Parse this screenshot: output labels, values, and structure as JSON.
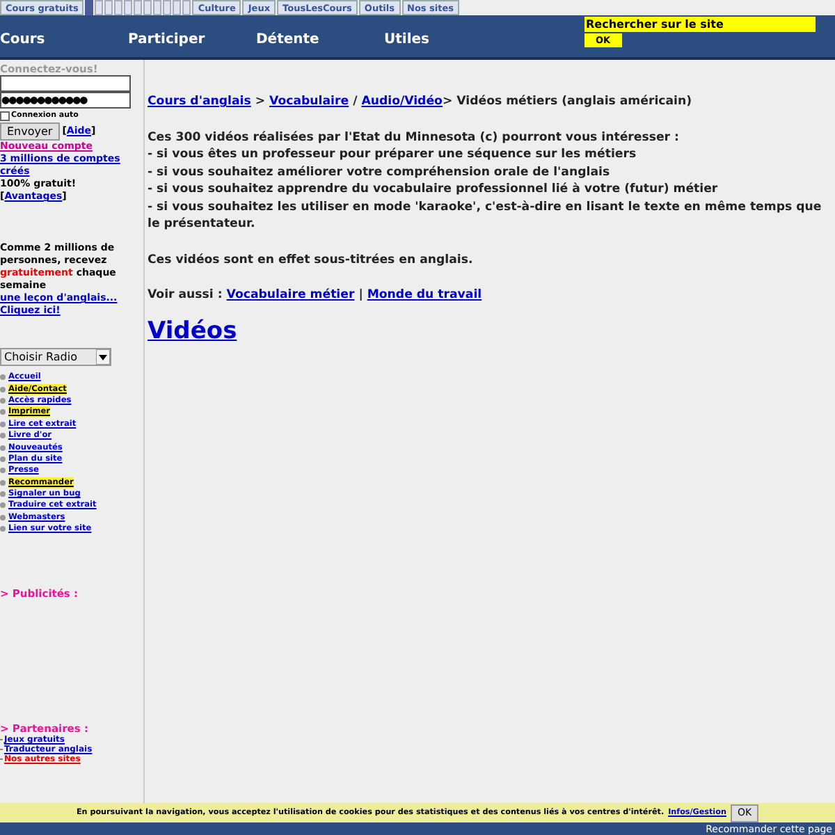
{
  "top_tabs": [
    {
      "label": "Cours gratuits",
      "kind": "text"
    },
    {
      "kind": "active"
    },
    {
      "kind": "blank"
    },
    {
      "kind": "blank"
    },
    {
      "kind": "blank"
    },
    {
      "kind": "blank"
    },
    {
      "kind": "blank"
    },
    {
      "kind": "blank"
    },
    {
      "kind": "blank"
    },
    {
      "kind": "blank"
    },
    {
      "kind": "blank"
    },
    {
      "kind": "blank"
    },
    {
      "label": "Culture",
      "kind": "text"
    },
    {
      "label": "Jeux",
      "kind": "text"
    },
    {
      "label": "TousLesCours",
      "kind": "text"
    },
    {
      "label": "Outils",
      "kind": "text"
    },
    {
      "label": "Nos sites",
      "kind": "text"
    }
  ],
  "nav": [
    "Cours",
    "Participer",
    "Détente",
    "Utiles"
  ],
  "search": {
    "label": "Rechercher sur le site",
    "button": "OK"
  },
  "login": {
    "title": "Connectez-vous!",
    "password": "●●●●●●●●●●●●",
    "auto_label": "Connexion auto",
    "auto_checked": false,
    "submit": "Envoyer",
    "help_open": "[",
    "help": "Aide",
    "help_close": "]",
    "new_account": "Nouveau compte",
    "accounts": "3 millions de comptes créés",
    "free": "100% gratuit!",
    "adv_open": "[",
    "advantages": "Avantages",
    "adv_close": "]"
  },
  "promo": {
    "text_1": "Comme 2 millions de personnes, recevez",
    "highlight": "gratuitement",
    "text_2": "chaque semaine",
    "link": "une leçon d'anglais...",
    "cta": "Cliquez ici!"
  },
  "radio": {
    "label": "Choisir Radio"
  },
  "menu": [
    {
      "label": "Accueil",
      "highlighted": false
    },
    {
      "label": "Aide/Contact",
      "highlighted": true
    },
    {
      "label": "Accès rapides",
      "highlighted": false
    },
    {
      "label": "Imprimer",
      "highlighted": true
    },
    {
      "label": "Lire cet extrait",
      "highlighted": false
    },
    {
      "label": "Livre d'or",
      "highlighted": false
    },
    {
      "label": "Nouveautés",
      "highlighted": false
    },
    {
      "label": "Plan du site",
      "highlighted": false
    },
    {
      "label": "Presse",
      "highlighted": false
    },
    {
      "label": "Recommander",
      "highlighted": true
    },
    {
      "label": "Signaler un bug",
      "highlighted": false
    },
    {
      "label": "Traduire cet extrait",
      "highlighted": false
    },
    {
      "label": "Webmasters",
      "highlighted": false
    },
    {
      "label": "Lien sur votre site",
      "highlighted": false
    }
  ],
  "ads_heading": "> Publicités :",
  "partners": {
    "heading": "> Partenaires :",
    "links": [
      {
        "label": "Jeux gratuits",
        "color": "#0000cc"
      },
      {
        "label": "Traducteur anglais",
        "color": "#0000cc"
      },
      {
        "label": "Nos autres sites",
        "color": "#ee0000"
      }
    ]
  },
  "breadcrumb": {
    "links": [
      "Cours d'anglais",
      "Vocabulaire",
      "Audio/Vidéo"
    ],
    "sep_1": ">",
    "sep_2": "/",
    "current": "> Vidéos métiers (anglais américain)"
  },
  "intro": [
    "Ces 300 vidéos réalisées par l'Etat du Minnesota (c) pourront vous intéresser :",
    "- si vous êtes un professeur pour préparer une séquence sur les métiers",
    "- si vous souhaitez améliorer votre compréhension orale de l'anglais",
    "- si vous souhaitez apprendre du vocabulaire professionnel lié à votre (futur) métier",
    "- si vous souhaitez les utiliser en mode 'karaoke', c'est-à-dire en lisant le texte en même temps que le présentateur."
  ],
  "subtitles_note": "Ces vidéos sont en effet sous-titrées en anglais.",
  "see_also": {
    "label": "Voir aussi :",
    "links": [
      "Vocabulaire métier",
      "Monde du travail"
    ],
    "sep": "|"
  },
  "heading": "Vidéos",
  "cookie": {
    "text": "En poursuivant la navigation, vous acceptez l'utilisation de cookies pour des statistiques et des contenus liés à vos centres d'intérêt.",
    "link": "Infos/Gestion",
    "button": "OK"
  },
  "footer": "Recommander cette page"
}
